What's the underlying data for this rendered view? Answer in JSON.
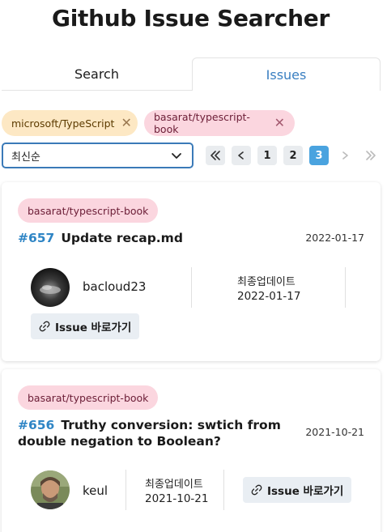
{
  "app": {
    "title": "Github Issue Searcher"
  },
  "tabs": [
    {
      "label": "Search",
      "active": false
    },
    {
      "label": "Issues",
      "active": true
    }
  ],
  "filters": [
    {
      "label": "microsoft/TypeScript",
      "color": "#fde8c4"
    },
    {
      "label": "basarat/typescript-book",
      "color": "#fbd6df"
    }
  ],
  "sort": {
    "selected": "최신순"
  },
  "pagination": {
    "pages": [
      "1",
      "2",
      "3"
    ],
    "current": "3"
  },
  "issues": [
    {
      "repo": "basarat/typescript-book",
      "number": "#657",
      "title": "Update recap.md",
      "date": "2022-01-17",
      "user": "bacloud23",
      "updated_label": "최종업데이트",
      "updated": "2022-01-17",
      "button": "Issue 바로가기"
    },
    {
      "repo": "basarat/typescript-book",
      "number": "#656",
      "title": "Truthy conversion: swtich from double negation to Boolean?",
      "date": "2021-10-21",
      "user": "keul",
      "updated_label": "최종업데이트",
      "updated": "2021-10-21",
      "button": "Issue 바로가기"
    }
  ],
  "colors": {
    "accent": "#3a7fc1",
    "active_page": "#4aa3df",
    "issue_number": "#2f85c5"
  }
}
